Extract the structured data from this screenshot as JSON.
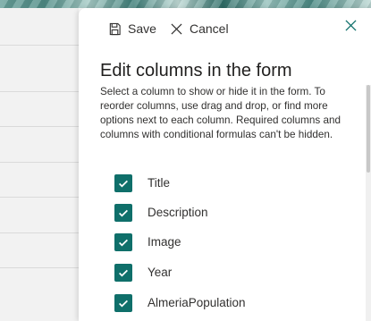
{
  "toolbar": {
    "save_label": "Save",
    "cancel_label": "Cancel"
  },
  "panel": {
    "title": "Edit columns in the form",
    "description": "Select a column to show or hide it in the form. To reorder columns, use drag and drop, or find more options next to each column. Required columns and columns with conditional formulas can't be hidden."
  },
  "columns": [
    {
      "label": "Title",
      "checked": true
    },
    {
      "label": "Description",
      "checked": true
    },
    {
      "label": "Image",
      "checked": true
    },
    {
      "label": "Year",
      "checked": true
    },
    {
      "label": "AlmeriaPopulation",
      "checked": true
    }
  ],
  "colors": {
    "accent": "#0f6f6a",
    "text": "#323130",
    "panel_bg": "#ffffff"
  },
  "icons": {
    "save": "save-icon",
    "cancel": "cancel-icon",
    "close": "close-icon",
    "checkmark": "checkmark-icon"
  }
}
